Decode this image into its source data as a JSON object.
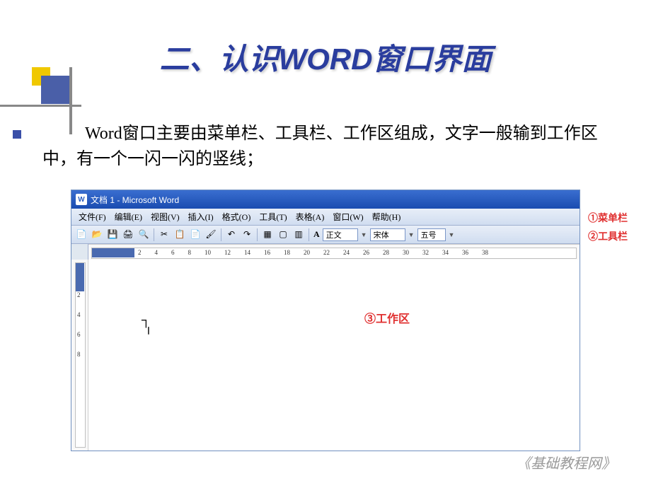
{
  "slide": {
    "title": "二、认识WORD窗口界面",
    "body": "Word窗口主要由菜单栏、工具栏、工作区组成，文字一般输到工作区中，有一个一闪一闪的竖线；",
    "footer": "《基础教程网》"
  },
  "word_window": {
    "title": "文档 1 - Microsoft Word",
    "menus": [
      "文件(F)",
      "编辑(E)",
      "视图(V)",
      "插入(I)",
      "格式(O)",
      "工具(T)",
      "表格(A)",
      "窗口(W)",
      "帮助(H)"
    ],
    "toolbar_style_prefix": "A",
    "toolbar_style": "正文",
    "toolbar_font": "宋体",
    "toolbar_size": "五号",
    "ruler_h": [
      "2",
      "4",
      "6",
      "8",
      "10",
      "12",
      "14",
      "16",
      "18",
      "20",
      "22",
      "24",
      "26",
      "28",
      "30",
      "32",
      "34",
      "36",
      "38"
    ],
    "ruler_v": [
      "2",
      "4",
      "6",
      "8"
    ]
  },
  "annotations": {
    "menubar": "①菜单栏",
    "toolbar": "②工具栏",
    "workarea": "③工作区"
  }
}
